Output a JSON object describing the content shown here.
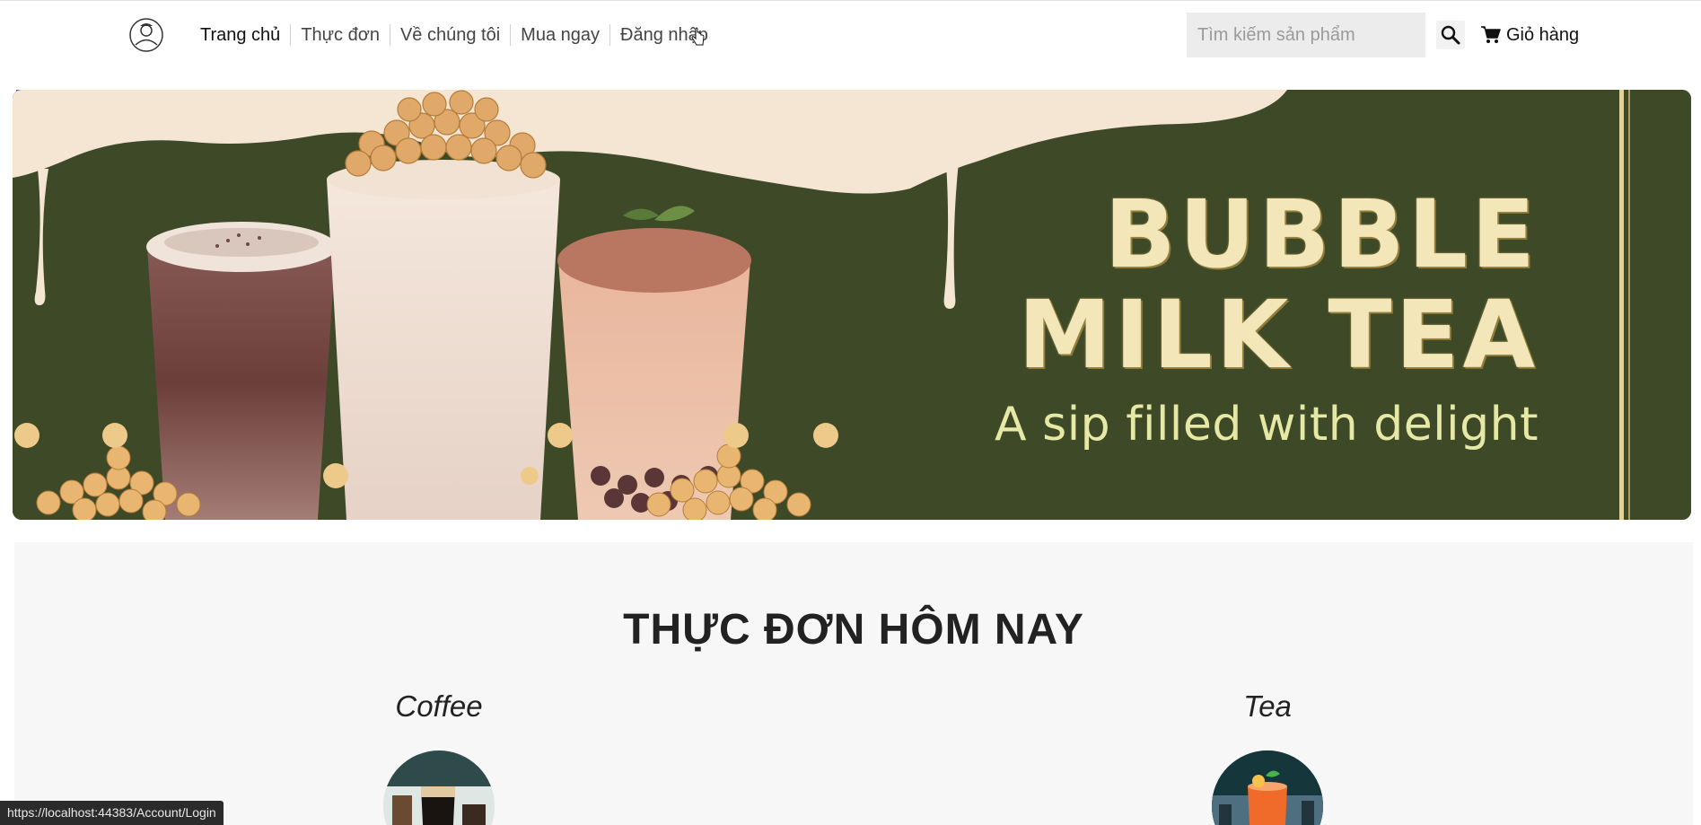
{
  "nav": {
    "items": [
      {
        "label": "Trang chủ"
      },
      {
        "label": "Thực đơn"
      },
      {
        "label": "Về chúng tôi"
      },
      {
        "label": "Mua ngay"
      },
      {
        "label": "Đăng nhập"
      }
    ],
    "search_placeholder": "Tìm kiếm sản phẩm",
    "cart_label": "Giỏ hàng"
  },
  "banner": {
    "title": "BUBBLE\nMILK TEA",
    "subtitle": "A sip filled with delight"
  },
  "menu": {
    "title": "THỰC ĐƠN HÔM NAY",
    "categories": [
      {
        "label": "Coffee"
      },
      {
        "label": "Tea"
      }
    ]
  },
  "status_url": "https://localhost:44383/Account/Login",
  "colors": {
    "banner_bg": "#3e4a27",
    "banner_title": "#f3e6b9",
    "banner_subtitle": "#e6e8a6",
    "cream": "#f5e6d3",
    "section_bg": "#f7f7f7"
  }
}
